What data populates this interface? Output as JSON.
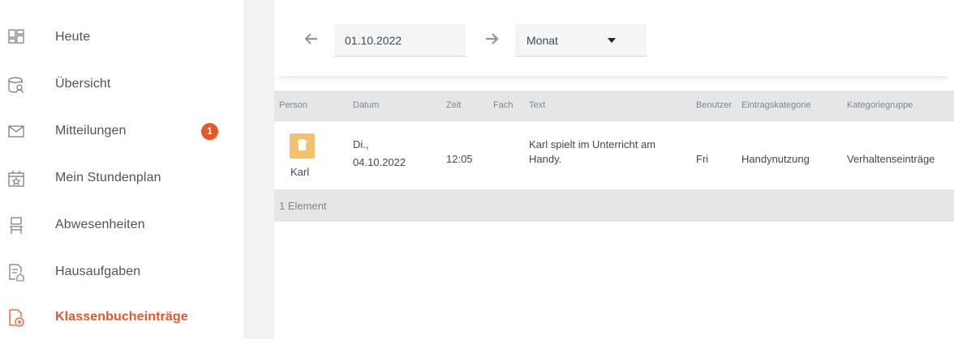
{
  "sidebar": {
    "items": [
      {
        "label": "Heute",
        "icon": "dashboard-icon"
      },
      {
        "label": "Übersicht",
        "icon": "overview-icon"
      },
      {
        "label": "Mitteilungen",
        "icon": "mail-icon",
        "badge": "1"
      },
      {
        "label": "Mein Stundenplan",
        "icon": "calendar-icon"
      },
      {
        "label": "Abwesenheiten",
        "icon": "chair-icon"
      },
      {
        "label": "Hausaufgaben",
        "icon": "homework-icon"
      },
      {
        "label": "Klassenbucheinträge",
        "icon": "classbook-icon",
        "active": true
      }
    ]
  },
  "toolbar": {
    "date_value": "01.10.2022",
    "range_value": "Monat"
  },
  "table": {
    "headers": [
      "Person",
      "Datum",
      "Zeit",
      "Fach",
      "Text",
      "Benutzer",
      "Eintragskategorie",
      "Kategoriegruppe"
    ],
    "rows": [
      {
        "person": "Karl",
        "date_line1": "Di.,",
        "date_line2": "04.10.2022",
        "time": "12:05",
        "subject": "",
        "text_line1": "Karl spielt im Unterricht am",
        "text_line2": "Handy.",
        "user": "Fri",
        "category": "Handynutzung",
        "group": "Verhaltenseinträge"
      }
    ],
    "footer": "1 Element"
  },
  "colors": {
    "accent": "#e8572a",
    "header_bg": "#e4e6e8",
    "avatar": "#f7c06a"
  }
}
